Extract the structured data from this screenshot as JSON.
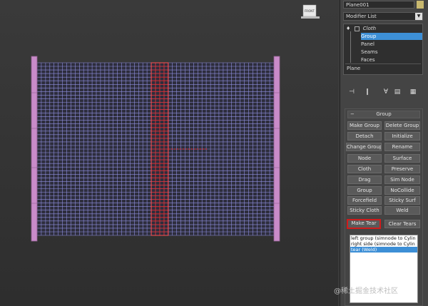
{
  "viewport": {
    "navcube_label": "FRONT"
  },
  "panel": {
    "object_name": "Plane001",
    "object_color": "#c8b86e",
    "modifier_list_label": "Modifier List",
    "stack": {
      "cloth": "Cloth",
      "items": [
        "Group",
        "Panel",
        "Seams",
        "Faces"
      ],
      "selected": "Group",
      "base": "Plane"
    },
    "toolbar_icons": [
      "pin-stack-icon",
      "show-end-result-icon",
      "make-unique-icon",
      "remove-modifier-icon",
      "configure-sets-icon"
    ]
  },
  "group_rollout": {
    "title": "Group",
    "buttons": {
      "make_group": "Make Group",
      "delete_group": "Delete Group",
      "detach": "Detach",
      "initialize": "Initialize",
      "change_group": "Change Group",
      "rename": "Rename",
      "node": "Node",
      "surface": "Surface",
      "cloth": "Cloth",
      "preserve": "Preserve",
      "drag": "Drag",
      "sim_node": "Sim Node",
      "group": "Group",
      "nocollide": "NoCollide",
      "forcefield": "Forcefield",
      "sticky_surf": "Sticky Surf",
      "sticky_cloth": "Sticky Cloth",
      "weld": "Weld",
      "make_tear": "Make Tear",
      "clear_tears": "Clear Tears"
    },
    "group_list": [
      "left group (simnode  to  Cylin",
      "right side (simnode  to  Cylin",
      "tear (Weld)"
    ],
    "group_list_selected": 2
  },
  "watermark": "@稀土掘金技术社区",
  "colors": {
    "mesh": "#8f8fe0",
    "selection": "#e02a2a",
    "accent": "#3d8fd6",
    "highlight": "#d01c1c",
    "cylinder": "#c98bc9"
  }
}
